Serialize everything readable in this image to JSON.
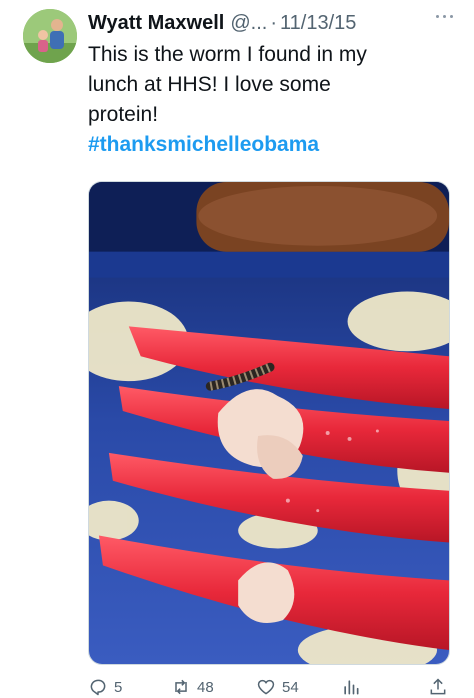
{
  "author": {
    "name": "Wyatt Maxwell",
    "handle": "@...",
    "separator": "·",
    "date": "11/13/15"
  },
  "tweet": {
    "lines": [
      "This is the worm I found in my",
      "lunch at HHS!  I love some",
      "protein!"
    ],
    "hashtag": "#thanksmichelleobama"
  },
  "actions": {
    "replies": "5",
    "retweets": "48",
    "likes": "54"
  },
  "icons": {
    "more": "more-icon",
    "reply": "reply-icon",
    "retweet": "retweet-icon",
    "like": "heart-icon",
    "views": "views-icon",
    "share": "share-icon"
  },
  "colors": {
    "hashtag": "#1d9bf0",
    "secondary_text": "#536471",
    "fork": "#e8283a",
    "tray": "#1f3d8f"
  }
}
